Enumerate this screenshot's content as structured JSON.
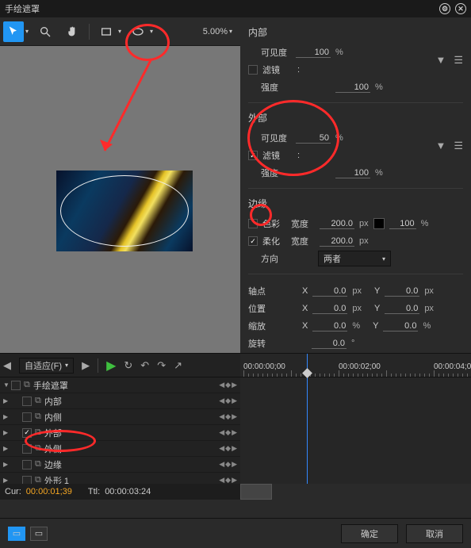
{
  "title": "手绘遮罩",
  "toolbar": {
    "zoom": "5.00%"
  },
  "inner": {
    "title": "内部",
    "visibility_label": "可见度",
    "visibility": "100",
    "visibility_unit": "%",
    "filter_label": "滤镜",
    "filter_checked": false,
    "filter_value": ":",
    "strength_label": "强度",
    "strength": "100",
    "strength_unit": "%"
  },
  "outer": {
    "title": "外部",
    "visibility_label": "可见度",
    "visibility": "50",
    "visibility_unit": "%",
    "filter_label": "滤镜",
    "filter_checked": true,
    "filter_value": ":",
    "strength_label": "强度",
    "strength": "100",
    "strength_unit": "%"
  },
  "edge": {
    "title": "边缘",
    "color_label": "色彩",
    "color_checked": false,
    "width_label": "宽度",
    "width1": "200.0",
    "unit_px": "px",
    "pct_value": "100",
    "pct_unit": "%",
    "soften_label": "柔化",
    "soften_checked": true,
    "width2": "200.0",
    "direction_label": "方向",
    "direction_value": "两者"
  },
  "transform": {
    "anchor_label": "轴点",
    "pos_label": "位置",
    "scale_label": "缩放",
    "rot_label": "旋转",
    "x": "X",
    "y": "Y",
    "anchor_x": "0.0",
    "anchor_y": "0.0",
    "pos_x": "0.0",
    "pos_y": "0.0",
    "scale_x": "0.0",
    "scale_y": "0.0",
    "rotation": "0.0",
    "px": "px",
    "pct": "%",
    "deg": "°"
  },
  "timeline": {
    "fit_label": "自适应(F)",
    "times": [
      "00:00:00;00",
      "00:00:02;00",
      "00:00:04;0"
    ],
    "tree": [
      {
        "label": "手绘遮罩",
        "indent": 0,
        "check": true,
        "expand": "▼",
        "icon": true
      },
      {
        "label": "内部",
        "indent": 1,
        "check": false,
        "expand": "▶",
        "icon": true
      },
      {
        "label": "内侧",
        "indent": 1,
        "check": false,
        "expand": "▶",
        "icon": true
      },
      {
        "label": "外部",
        "indent": 1,
        "check": true,
        "expand": "▶",
        "icon": true
      },
      {
        "label": "外侧",
        "indent": 1,
        "check": false,
        "expand": "▶",
        "icon": true
      },
      {
        "label": "边缘",
        "indent": 1,
        "check": false,
        "expand": "▶",
        "icon": true
      },
      {
        "label": "外形 1",
        "indent": 1,
        "check": false,
        "expand": "▶",
        "icon": true
      }
    ],
    "status_cur_label": "Cur:",
    "status_cur": "00:00:01;39",
    "status_ttl_label": "Ttl:",
    "status_ttl": "00:00:03:24"
  },
  "buttons": {
    "ok": "确定",
    "cancel": "取消"
  }
}
